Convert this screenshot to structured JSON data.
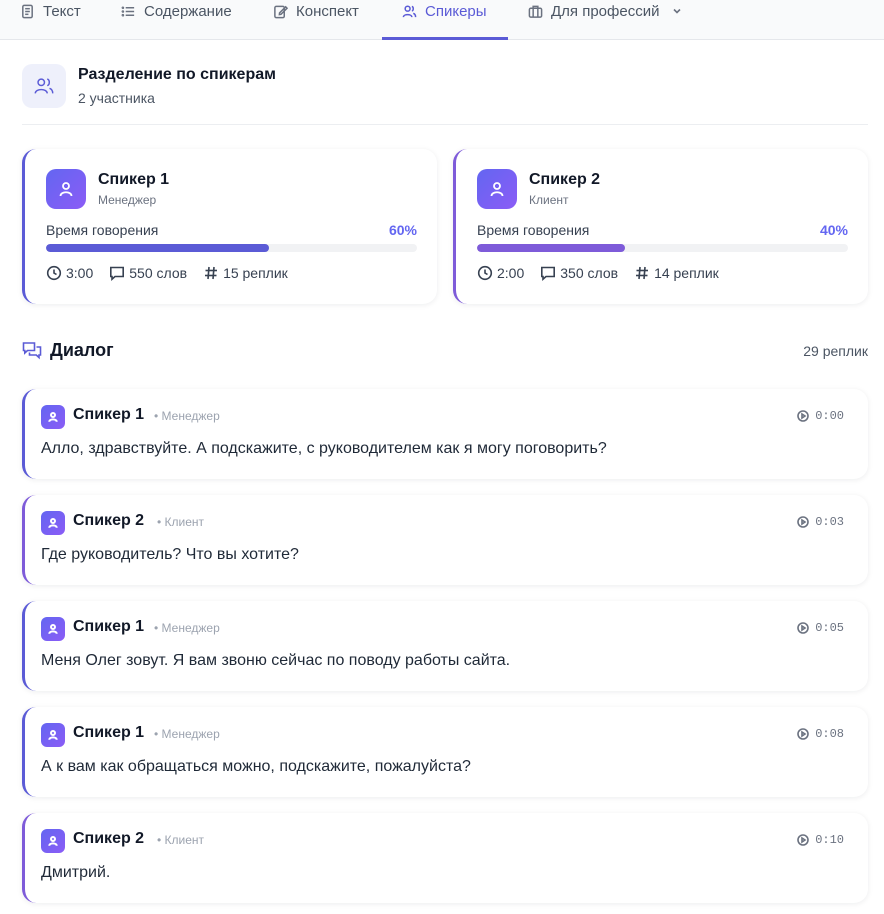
{
  "tabs": [
    {
      "label": "Текст",
      "icon": "document-icon"
    },
    {
      "label": "Содержание",
      "icon": "list-icon"
    },
    {
      "label": "Конспект",
      "icon": "notes-icon"
    },
    {
      "label": "Спикеры",
      "icon": "users-icon",
      "active": true
    },
    {
      "label": "Для профессий",
      "icon": "briefcase-icon"
    }
  ],
  "header": {
    "title": "Разделение по спикерам",
    "subtitle": "2 участника"
  },
  "speakers": [
    {
      "name": "Спикер 1",
      "role": "Менеджер",
      "talk_label": "Время говорения",
      "talk_pct_label": "60%",
      "talk_pct": 60,
      "duration": "3:00",
      "words": "550 слов",
      "replies": "15 реплик",
      "color": "#5b5bd6"
    },
    {
      "name": "Спикер 2",
      "role": "Клиент",
      "talk_label": "Время говорения",
      "talk_pct_label": "40%",
      "talk_pct": 40,
      "duration": "2:00",
      "words": "350 слов",
      "replies": "14 реплик",
      "color": "#7e5bd9"
    }
  ],
  "dialog": {
    "title": "Диалог",
    "count": "29 реплик",
    "messages": [
      {
        "speaker": "Спикер 1",
        "role": "• Менеджер",
        "time": "0:00",
        "text": "Алло, здравствуйте. А подскажите, с руководителем как я могу поговорить?"
      },
      {
        "speaker": "Спикер 2",
        "role": "• Клиент",
        "time": "0:03",
        "text": "Где руководитель? Что вы хотите?"
      },
      {
        "speaker": "Спикер 1",
        "role": "• Менеджер",
        "time": "0:05",
        "text": "Меня Олег зовут. Я вам звоню сейчас по поводу работы сайта."
      },
      {
        "speaker": "Спикер 1",
        "role": "• Менеджер",
        "time": "0:08",
        "text": "А к вам как обращаться можно, подскажите, пожалуйста?"
      },
      {
        "speaker": "Спикер 2",
        "role": "• Клиент",
        "time": "0:10",
        "text": "Дмитрий."
      }
    ]
  }
}
